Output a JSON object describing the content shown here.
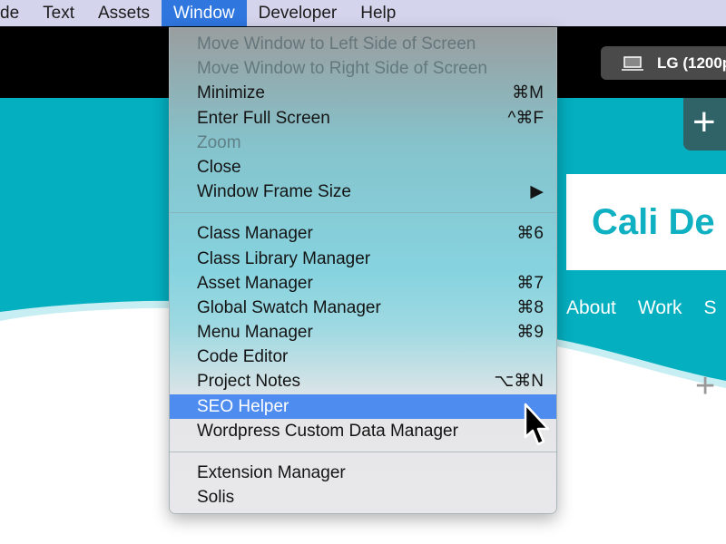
{
  "menubar": {
    "items": [
      "de",
      "Text",
      "Assets",
      "Window",
      "Developer",
      "Help"
    ],
    "active": "Window"
  },
  "toolbar": {
    "device_label": "LG (1200p",
    "add_label": "+"
  },
  "site": {
    "logo_text": "Cali De",
    "nav": [
      "About",
      "Work",
      "S"
    ],
    "add_label": "+",
    "accent": "#04afc0"
  },
  "menu": {
    "group1": [
      {
        "label": "Move Window to Left Side of Screen",
        "shortcut": "",
        "disabled": true
      },
      {
        "label": "Move Window to Right Side of Screen",
        "shortcut": "",
        "disabled": true
      },
      {
        "label": "Minimize",
        "shortcut": "⌘M"
      },
      {
        "label": "Enter Full Screen",
        "shortcut": "^⌘F"
      },
      {
        "label": "Zoom",
        "shortcut": "",
        "disabled": true
      },
      {
        "label": "Close",
        "shortcut": ""
      },
      {
        "label": "Window Frame Size",
        "shortcut": "▶"
      }
    ],
    "group2": [
      {
        "label": "Class Manager",
        "shortcut": "⌘6"
      },
      {
        "label": "Class Library Manager",
        "shortcut": ""
      },
      {
        "label": "Asset Manager",
        "shortcut": "⌘7"
      },
      {
        "label": "Global Swatch Manager",
        "shortcut": "⌘8"
      },
      {
        "label": "Menu Manager",
        "shortcut": "⌘9"
      },
      {
        "label": "Code Editor",
        "shortcut": ""
      },
      {
        "label": "Project Notes",
        "shortcut": "⌥⌘N"
      },
      {
        "label": "SEO Helper",
        "shortcut": "",
        "highlighted": true
      },
      {
        "label": "Wordpress Custom Data Manager",
        "shortcut": ""
      }
    ],
    "group3": [
      {
        "label": "Extension Manager",
        "shortcut": ""
      },
      {
        "label": "Solis",
        "shortcut": ""
      }
    ]
  }
}
